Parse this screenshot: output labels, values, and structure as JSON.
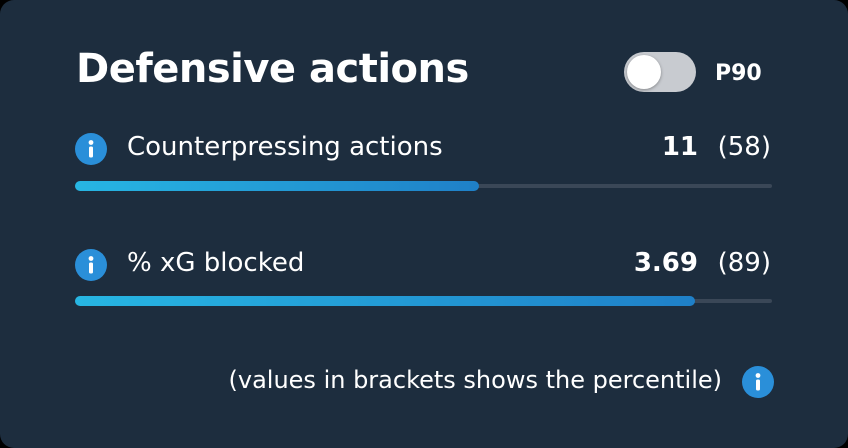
{
  "panel": {
    "title": "Defensive actions",
    "toggle_label": "P90",
    "toggle_on": false
  },
  "metrics": [
    {
      "label": "Counterpressing actions",
      "value": "11",
      "percentile_text": "(58)",
      "percentile": 58,
      "icon": "info-icon"
    },
    {
      "label": "% xG blocked",
      "value": "3.69",
      "percentile_text": "(89)",
      "percentile": 89,
      "icon": "info-icon"
    }
  ],
  "footnote": "(values in brackets shows the percentile)",
  "colors": {
    "background": "#1d2d3e",
    "accent": "#2a8fd9",
    "bar_track": "#3a4757",
    "toggle_off": "#c8cbd0"
  }
}
